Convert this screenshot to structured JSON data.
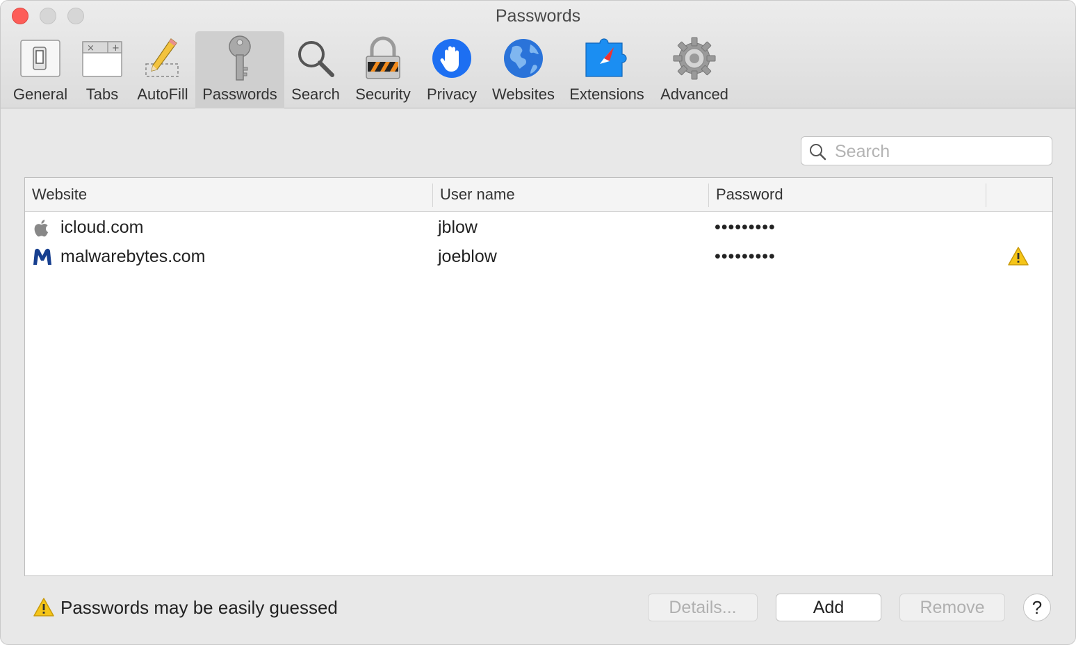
{
  "window": {
    "title": "Passwords"
  },
  "toolbar": {
    "items": [
      {
        "label": "General",
        "icon": "switch-icon"
      },
      {
        "label": "Tabs",
        "icon": "tabs-icon"
      },
      {
        "label": "AutoFill",
        "icon": "pencil-icon"
      },
      {
        "label": "Passwords",
        "icon": "key-icon",
        "selected": true
      },
      {
        "label": "Search",
        "icon": "magnifier-icon"
      },
      {
        "label": "Security",
        "icon": "padlock-icon"
      },
      {
        "label": "Privacy",
        "icon": "hand-icon"
      },
      {
        "label": "Websites",
        "icon": "globe-icon"
      },
      {
        "label": "Extensions",
        "icon": "puzzle-icon"
      },
      {
        "label": "Advanced",
        "icon": "gear-icon"
      }
    ]
  },
  "search": {
    "placeholder": "Search",
    "value": ""
  },
  "table": {
    "columns": [
      "Website",
      "User name",
      "Password",
      ""
    ],
    "rows": [
      {
        "website": "icloud.com",
        "icon": "apple-icon",
        "username": "jblow",
        "password": "•••••••••",
        "warning": false
      },
      {
        "website": "malwarebytes.com",
        "icon": "malwarebytes-icon",
        "username": "joeblow",
        "password": "•••••••••",
        "warning": true
      }
    ]
  },
  "footer": {
    "warning_text": "Passwords may be easily guessed",
    "details_label": "Details...",
    "add_label": "Add",
    "remove_label": "Remove",
    "help_label": "?"
  },
  "colors": {
    "accent": "#1d6ff2",
    "warning": "#f5c518",
    "close": "#fd5d58"
  }
}
